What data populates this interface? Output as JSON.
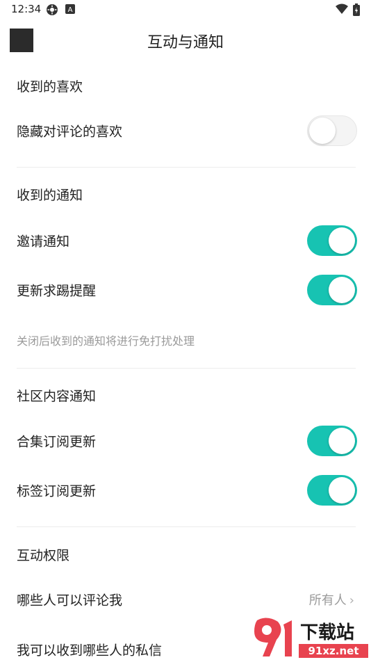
{
  "status_bar": {
    "time": "12:34",
    "left_icons": [
      "settings-gear-icon",
      "a-badge-icon"
    ],
    "right_icons": [
      "wifi-icon",
      "battery-icon"
    ]
  },
  "header": {
    "title": "互动与通知"
  },
  "sections": {
    "likes": {
      "title": "收到的喜欢",
      "hide_comment_likes": {
        "label": "隐藏对评论的喜欢",
        "enabled": false
      }
    },
    "notifications": {
      "title": "收到的通知",
      "invite": {
        "label": "邀请通知",
        "enabled": true
      },
      "update_reminder": {
        "label": "更新求踢提醒",
        "enabled": true
      },
      "hint": "关闭后收到的通知将进行免打扰处理"
    },
    "community": {
      "title": "社区内容通知",
      "collection_update": {
        "label": "合集订阅更新",
        "enabled": true
      },
      "tag_update": {
        "label": "标签订阅更新",
        "enabled": true
      }
    },
    "permissions": {
      "title": "互动权限",
      "who_can_comment": {
        "label": "哪些人可以评论我",
        "value": "所有人"
      },
      "private_messages": {
        "label": "我可以收到哪些人的私信"
      }
    }
  },
  "watermark": {
    "line1": "下载站",
    "line2": "91xz.net"
  },
  "colors": {
    "accent": "#17c3b2",
    "text": "#222222",
    "hint": "#9a9a9a",
    "divider": "#ececec"
  }
}
